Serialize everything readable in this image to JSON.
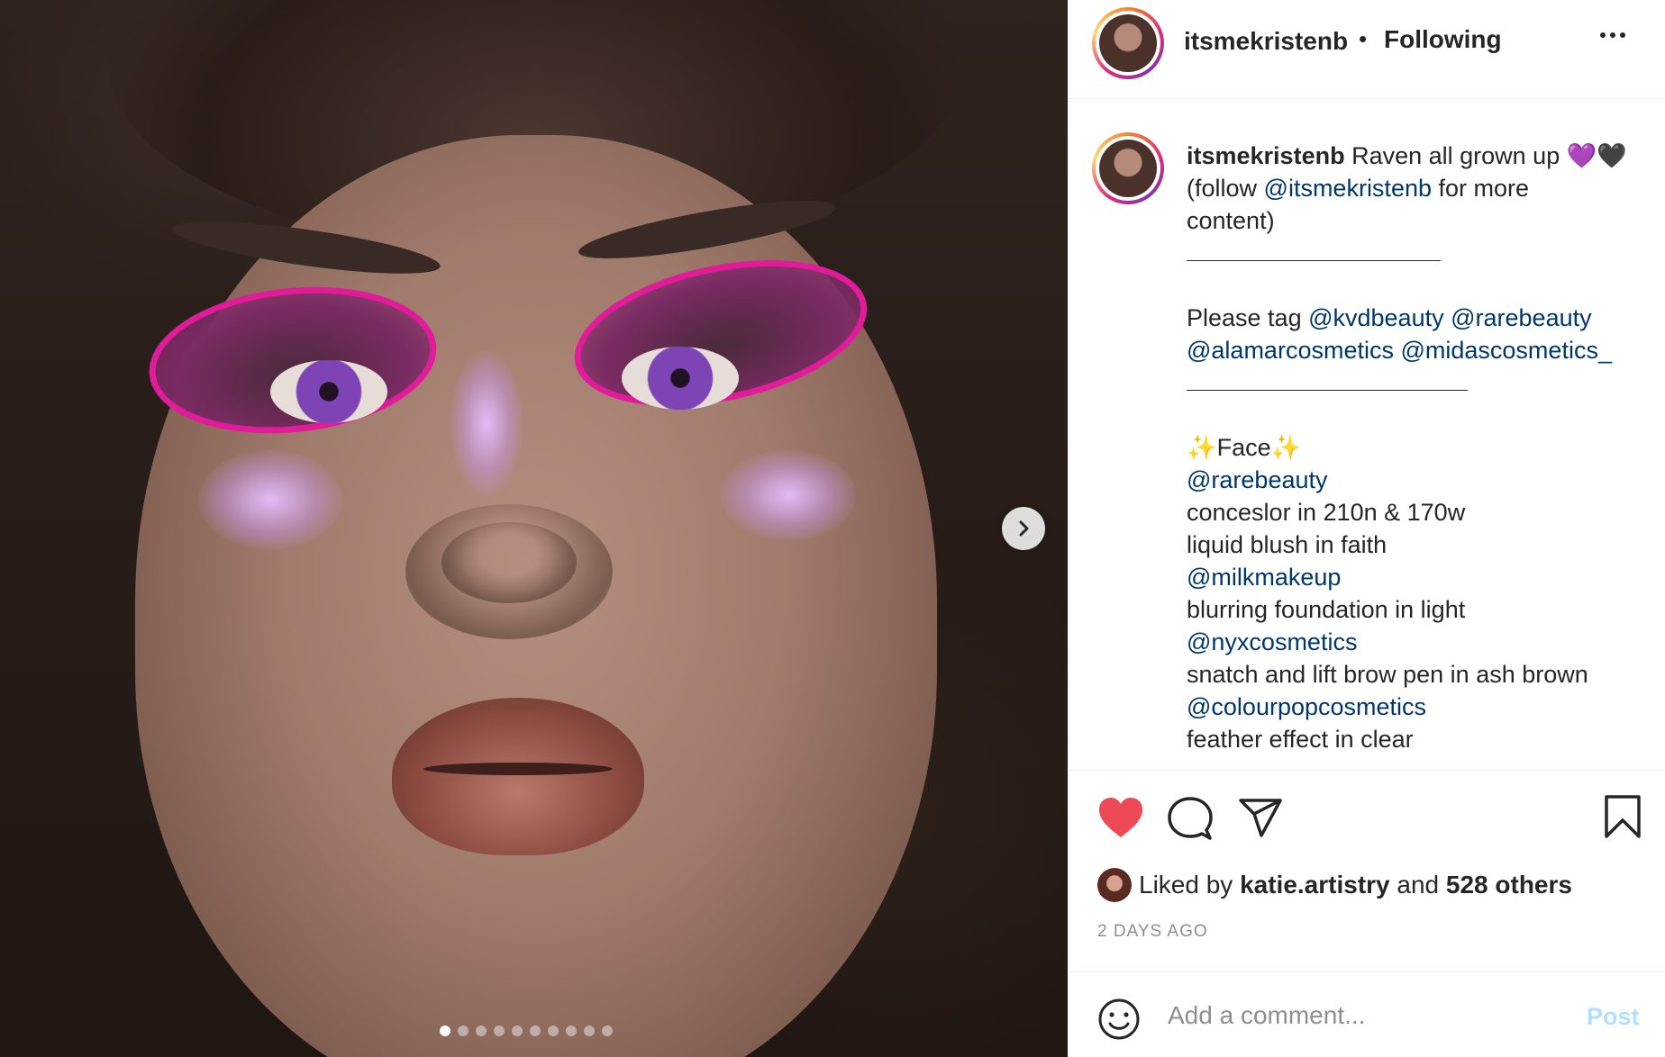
{
  "post": {
    "carousel_total": 10,
    "carousel_index": 1
  },
  "header": {
    "username": "itsmekristenb",
    "separator": "•",
    "follow_status": "Following"
  },
  "caption": {
    "username": "itsmekristenb",
    "line1_text": " Raven all grown up 💜🖤",
    "line2_pre": "(follow ",
    "line2_mention": "@itsmekristenb",
    "line2_post": " for more",
    "line3": "content)",
    "tag_prefix": "Please tag ",
    "tag_mention1": "@kvdbeauty",
    "tag_mention2": "@rarebeauty",
    "tag_mention3": "@alamarcosmetics",
    "tag_mention4": "@midascosmetics_",
    "face_heading": "✨Face✨",
    "brand1": "@rarebeauty",
    "brand1_item1": "conceslor in 210n & 170w",
    "brand1_item2": "liquid blush in faith",
    "brand2": "@milkmakeup",
    "brand2_item1": "blurring foundation in light",
    "brand3": "@nyxcosmetics",
    "brand3_item1": "snatch and lift brow pen in ash brown",
    "brand4": "@colourpopcosmetics",
    "brand4_item1": "feather effect in clear"
  },
  "likes": {
    "prefix": "Liked by ",
    "liker": "katie.artistry",
    "middle": " and ",
    "others": "528 others"
  },
  "timestamp": "2 DAYS AGO",
  "comment": {
    "placeholder": "Add a comment...",
    "post_label": "Post"
  },
  "colors": {
    "heart": "#ed4956",
    "mention": "#00376b",
    "post_disabled": "#b2dffc"
  },
  "icons": {
    "like": "heart-filled-icon",
    "comment": "speech-bubble-icon",
    "share": "paper-plane-icon",
    "save": "bookmark-icon",
    "next": "chevron-right-icon",
    "emoji": "smiley-icon",
    "more": "more-options-icon"
  }
}
